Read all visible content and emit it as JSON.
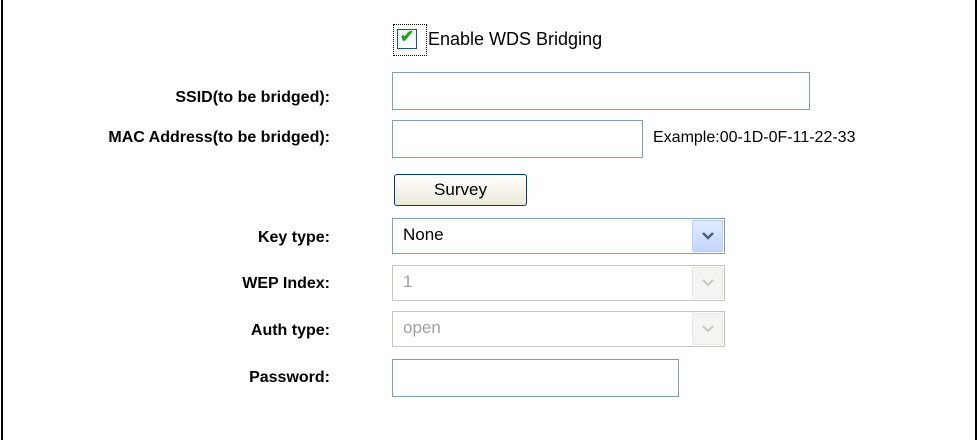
{
  "wds": {
    "enable_label": "Enable WDS Bridging",
    "enable_checked": true
  },
  "ssid": {
    "label": "SSID(to be bridged):",
    "value": ""
  },
  "mac": {
    "label": "MAC Address(to be bridged):",
    "value": "",
    "example": "Example:00-1D-0F-11-22-33"
  },
  "survey": {
    "label": "Survey"
  },
  "key_type": {
    "label": "Key type:",
    "value": "None"
  },
  "wep_index": {
    "label": "WEP Index:",
    "value": "1",
    "disabled": true
  },
  "auth_type": {
    "label": "Auth type:",
    "value": "open",
    "disabled": true
  },
  "password": {
    "label": "Password:",
    "value": ""
  },
  "colors": {
    "checkmark": "#21a121",
    "border": "#7f9db9",
    "disabled_text": "#a0a0a0"
  }
}
